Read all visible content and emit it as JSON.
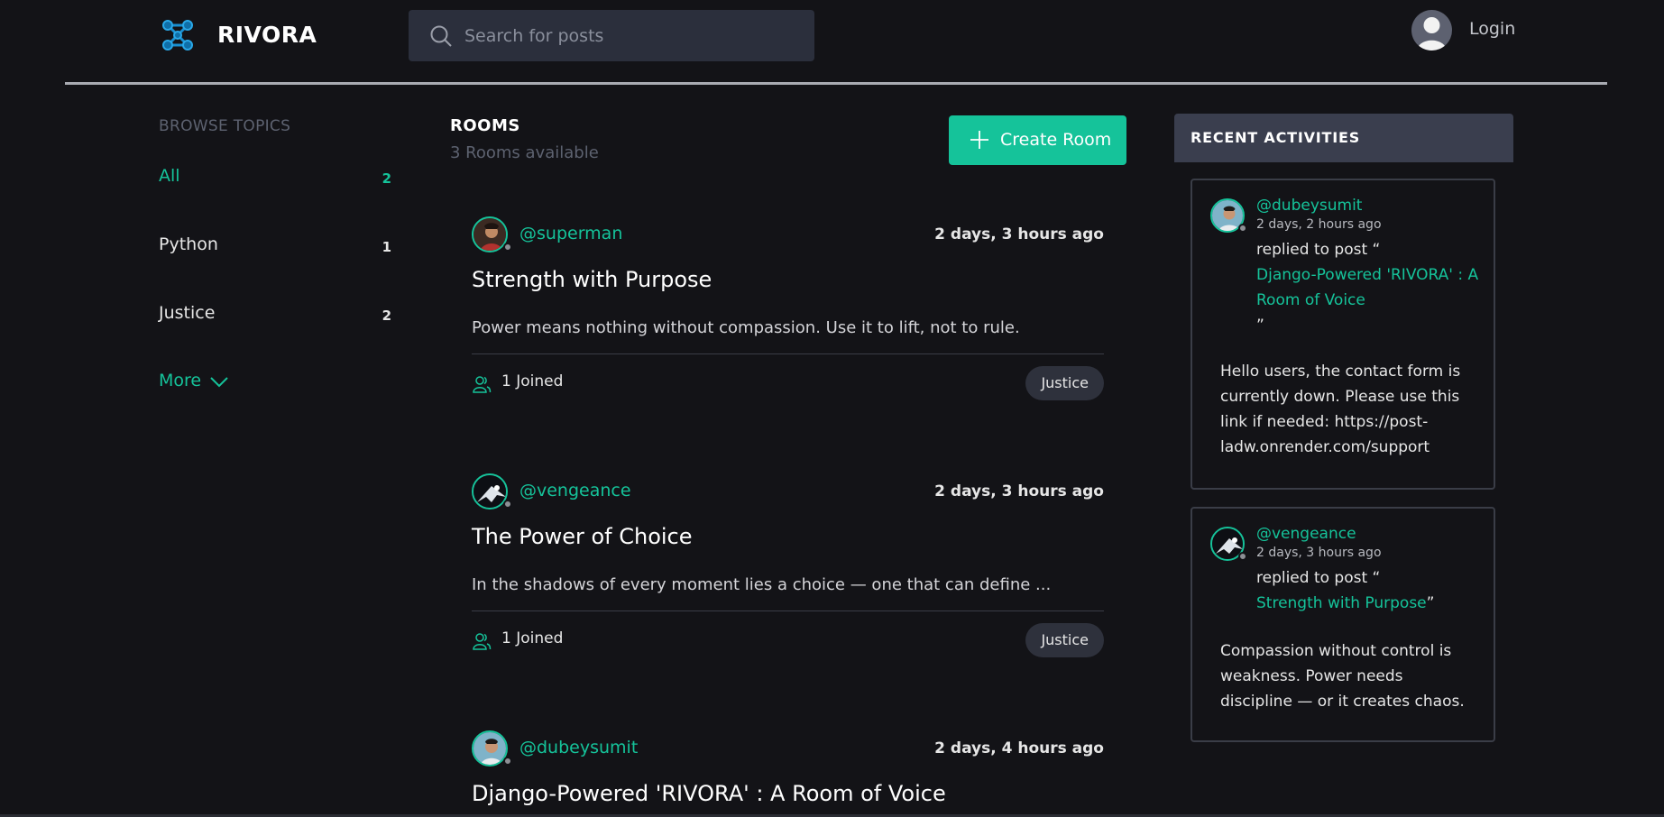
{
  "header": {
    "brand": "RIVORA",
    "search_placeholder": "Search for posts",
    "login_label": "Login"
  },
  "topics": {
    "title": "BROWSE TOPICS",
    "items": [
      {
        "name": "All",
        "count": "2"
      },
      {
        "name": "Python",
        "count": "1"
      },
      {
        "name": "Justice",
        "count": "2"
      }
    ],
    "more_label": "More"
  },
  "rooms": {
    "title": "ROOMS",
    "subtitle": "3 Rooms available",
    "create_label": "Create Room",
    "items": [
      {
        "user": "@superman",
        "time": "2 days, 3 hours ago",
        "title": "Strength with Purpose",
        "desc": "Power means nothing without compassion. Use it to lift, not to rule.",
        "joined": "1 Joined",
        "tag": "Justice"
      },
      {
        "user": "@vengeance",
        "time": "2 days, 3 hours ago",
        "title": "The Power of Choice",
        "desc": "In the shadows of every moment lies a choice — one that can define ...",
        "joined": "1 Joined",
        "tag": "Justice"
      },
      {
        "user": "@dubeysumit",
        "time": "2 days, 4 hours ago",
        "title": "Django-Powered 'RIVORA' : A Room of Voice"
      }
    ]
  },
  "activities": {
    "title": "RECENT ACTIVITIES",
    "items": [
      {
        "user": "@dubeysumit",
        "time": "2 days, 2 hours ago",
        "replied_prefix": "replied to post “",
        "post": "Django-Powered 'RIVORA' : A Room of Voice",
        "replied_suffix": "”",
        "body": "Hello users, the contact form is currently down. Please use this link if needed: https://post-ladw.onrender.com/support"
      },
      {
        "user": "@vengeance",
        "time": "2 days, 3 hours ago",
        "replied_prefix": "replied to post “",
        "post": "Strength with Purpose",
        "replied_suffix": "”",
        "body": "Compassion without control is weakness. Power needs discipline — or it creates chaos."
      }
    ]
  },
  "colors": {
    "accent": "#15c39a",
    "background": "#131317",
    "panel": "#2b2f3c"
  }
}
